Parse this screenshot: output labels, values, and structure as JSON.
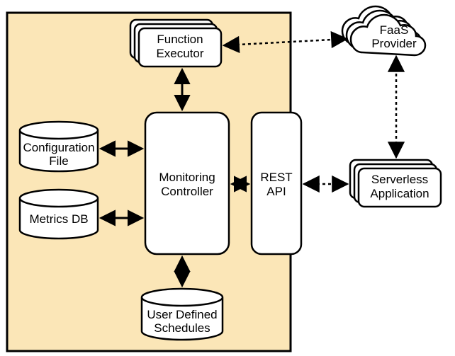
{
  "nodes": {
    "function_executor": "Function\nExecutor",
    "faas_provider": "FaaS\nProvider",
    "configuration_file": "Configuration\nFile",
    "monitoring_controller": "Monitoring\nController",
    "rest_api": "REST\nAPI",
    "metrics_db": "Metrics DB",
    "user_defined_schedules": "User Defined\nSchedules",
    "serverless_application": "Serverless\nApplication"
  },
  "edges": [
    {
      "from": "function_executor",
      "to": "faas_provider",
      "style": "dashed",
      "dir": "both"
    },
    {
      "from": "function_executor",
      "to": "monitoring_controller",
      "style": "solid",
      "dir": "both"
    },
    {
      "from": "configuration_file",
      "to": "monitoring_controller",
      "style": "solid",
      "dir": "both"
    },
    {
      "from": "metrics_db",
      "to": "monitoring_controller",
      "style": "solid",
      "dir": "both"
    },
    {
      "from": "monitoring_controller",
      "to": "rest_api",
      "style": "solid",
      "dir": "both"
    },
    {
      "from": "monitoring_controller",
      "to": "user_defined_schedules",
      "style": "solid",
      "dir": "both"
    },
    {
      "from": "rest_api",
      "to": "serverless_application",
      "style": "dashed",
      "dir": "both"
    },
    {
      "from": "serverless_application",
      "to": "faas_provider",
      "style": "dashed",
      "dir": "both"
    }
  ]
}
